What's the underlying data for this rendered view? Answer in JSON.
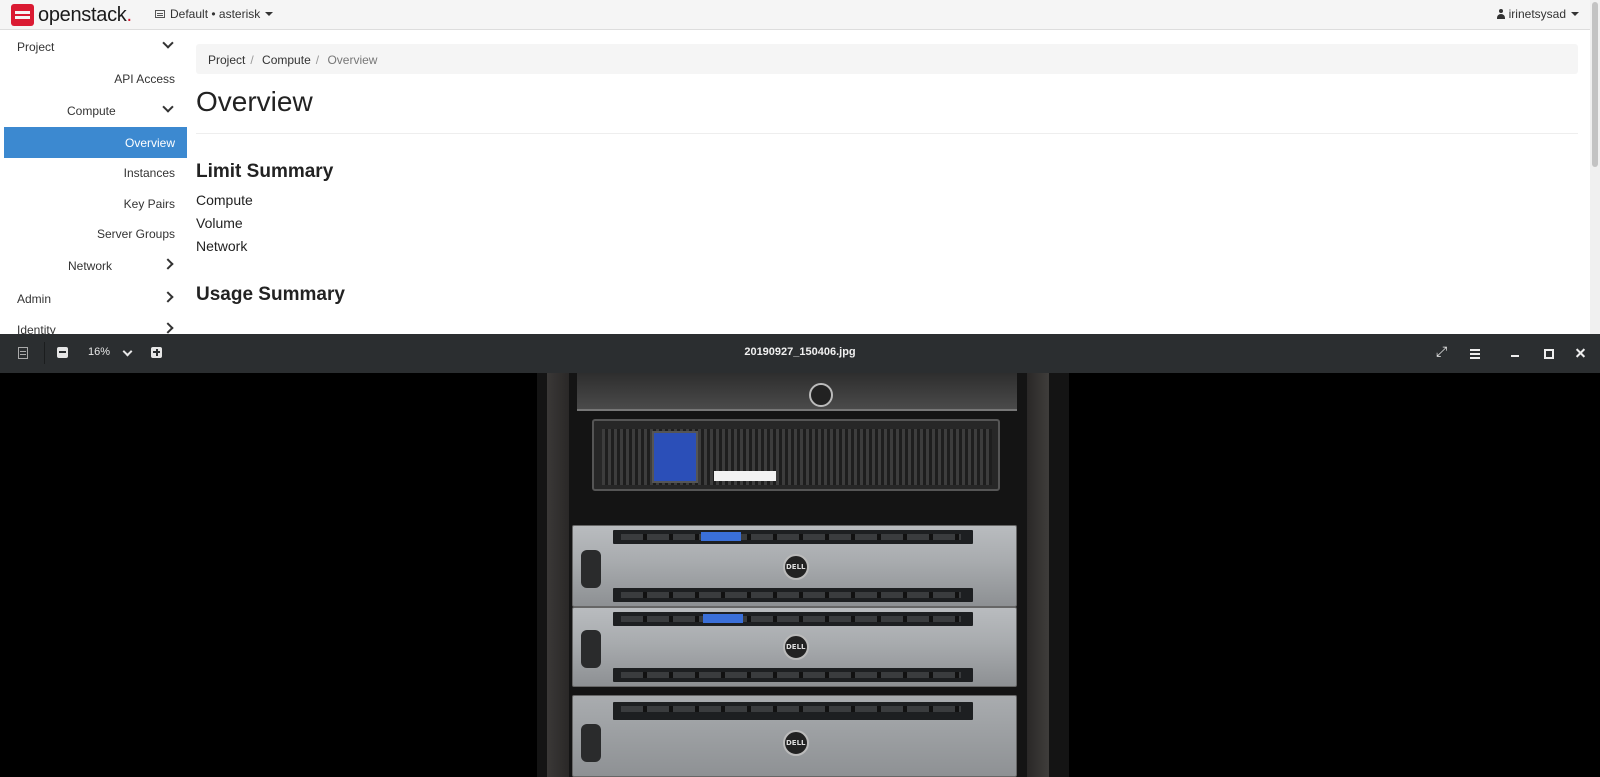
{
  "navbar": {
    "brand": "openstack",
    "brand_dot": ".",
    "project_picker": "Default • asterisk",
    "user": "irinetsysad"
  },
  "sidebar": {
    "items": [
      {
        "label": "Project",
        "level": 0,
        "expanded": true
      },
      {
        "label": "API Access",
        "level": 2
      },
      {
        "label": "Compute",
        "level": 1,
        "expanded": true
      },
      {
        "label": "Overview",
        "level": 2,
        "active": true
      },
      {
        "label": "Instances",
        "level": 2
      },
      {
        "label": "Key Pairs",
        "level": 2
      },
      {
        "label": "Server Groups",
        "level": 2
      },
      {
        "label": "Network",
        "level": 1,
        "expanded": false
      },
      {
        "label": "Admin",
        "level": 0,
        "expanded": false
      },
      {
        "label": "Identity",
        "level": 0,
        "expanded": false
      }
    ]
  },
  "main": {
    "breadcrumb": [
      "Project",
      "Compute",
      "Overview"
    ],
    "page_title": "Overview",
    "limit_summary": {
      "heading": "Limit Summary",
      "items": [
        "Compute",
        "Volume",
        "Network"
      ]
    },
    "usage_summary": {
      "heading": "Usage Summary"
    }
  },
  "viewer": {
    "filename": "20190927_150406.jpg",
    "zoom": "16%",
    "icons": [
      "gallery-icon",
      "zoom-out-icon",
      "zoom-in-icon",
      "fullscreen-icon",
      "menu-icon",
      "minimize-icon",
      "maximize-icon",
      "close-icon"
    ],
    "photo_subject": "server rack"
  },
  "colors": {
    "active_nav": "#3c89d0",
    "brand_red": "#da1a32",
    "viewer_bar": "#2b2e30"
  }
}
